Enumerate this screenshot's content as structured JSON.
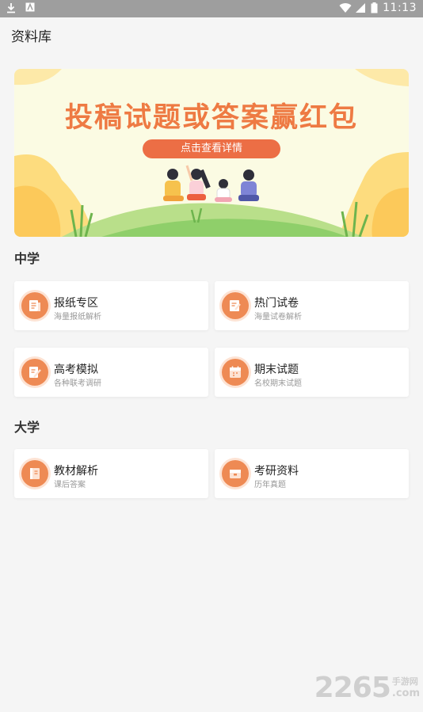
{
  "status_bar": {
    "time": "11:13"
  },
  "app_bar": {
    "title": "资料库"
  },
  "banner": {
    "headline": "投稿试题或答案赢红包",
    "button_label": "点击查看详情"
  },
  "sections": [
    {
      "title": "中学",
      "items": [
        {
          "name": "报纸专区",
          "subtitle": "海量报纸解析",
          "icon": "newspaper-icon"
        },
        {
          "name": "热门试卷",
          "subtitle": "海量试卷解析",
          "icon": "exam-paper-icon"
        },
        {
          "name": "高考模拟",
          "subtitle": "各种联考调研",
          "icon": "pen-document-icon"
        },
        {
          "name": "期末试题",
          "subtitle": "名校期末试题",
          "icon": "calendar-icon"
        }
      ]
    },
    {
      "title": "大学",
      "items": [
        {
          "name": "教材解析",
          "subtitle": "课后答案",
          "icon": "textbook-icon"
        },
        {
          "name": "考研资料",
          "subtitle": "历年真题",
          "icon": "folder-box-icon"
        }
      ]
    }
  ],
  "watermark": {
    "number": "2265",
    "brand": "手游网",
    "domain": ".com"
  },
  "colors": {
    "accent": "#ee8a54",
    "banner_text": "#ee7a43",
    "status_bar": "#9e9e9e"
  }
}
